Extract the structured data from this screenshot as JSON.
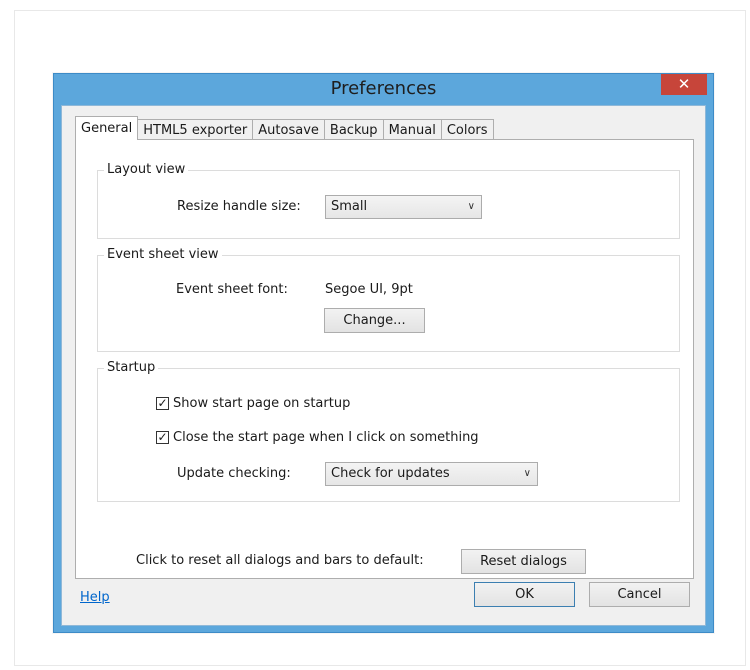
{
  "window": {
    "title": "Preferences",
    "close_icon": "close-icon"
  },
  "tabs": [
    {
      "label": "General",
      "active": true
    },
    {
      "label": "HTML5 exporter",
      "active": false
    },
    {
      "label": "Autosave",
      "active": false
    },
    {
      "label": "Backup",
      "active": false
    },
    {
      "label": "Manual",
      "active": false
    },
    {
      "label": "Colors",
      "active": false
    }
  ],
  "layout_view": {
    "title": "Layout view",
    "resize_label": "Resize handle size:",
    "resize_value": "Small"
  },
  "event_sheet_view": {
    "title": "Event sheet view",
    "font_label": "Event sheet font:",
    "font_value": "Segoe UI, 9pt",
    "change_button": "Change..."
  },
  "startup": {
    "title": "Startup",
    "show_start_page": {
      "label": "Show start page on startup",
      "checked": true
    },
    "close_start_page": {
      "label": "Close the start page when I click on something",
      "checked": true
    },
    "update_label": "Update checking:",
    "update_value": "Check for updates"
  },
  "reset": {
    "label": "Click to reset all dialogs and bars to default:",
    "button": "Reset dialogs"
  },
  "footer": {
    "help": "Help",
    "ok": "OK",
    "cancel": "Cancel"
  },
  "colors": {
    "title_bar": "#5ca7dc",
    "close_button": "#c7453a",
    "link": "#0066cc"
  }
}
